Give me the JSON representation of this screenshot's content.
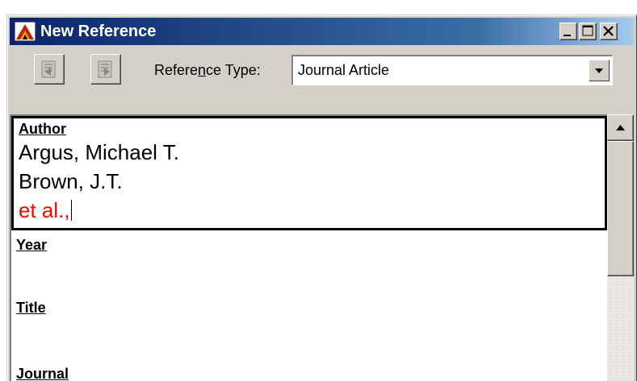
{
  "window": {
    "title": "New Reference",
    "colors": {
      "titlebar": "#0a246a",
      "face": "#d4d0c8",
      "highlight_text": "#ff0000"
    }
  },
  "toolbar": {
    "prev_icon": "previous-reference-icon",
    "next_icon": "next-reference-icon",
    "reference_type_label": "Reference Type:",
    "reference_type_value": "Journal Article"
  },
  "fields": {
    "author": {
      "label": "Author",
      "lines": [
        "Argus, Michael T.",
        "Brown, J.T."
      ],
      "editing_line": "et al.,"
    },
    "year": {
      "label": "Year"
    },
    "title": {
      "label": "Title"
    },
    "journal": {
      "label": "Journal"
    }
  }
}
